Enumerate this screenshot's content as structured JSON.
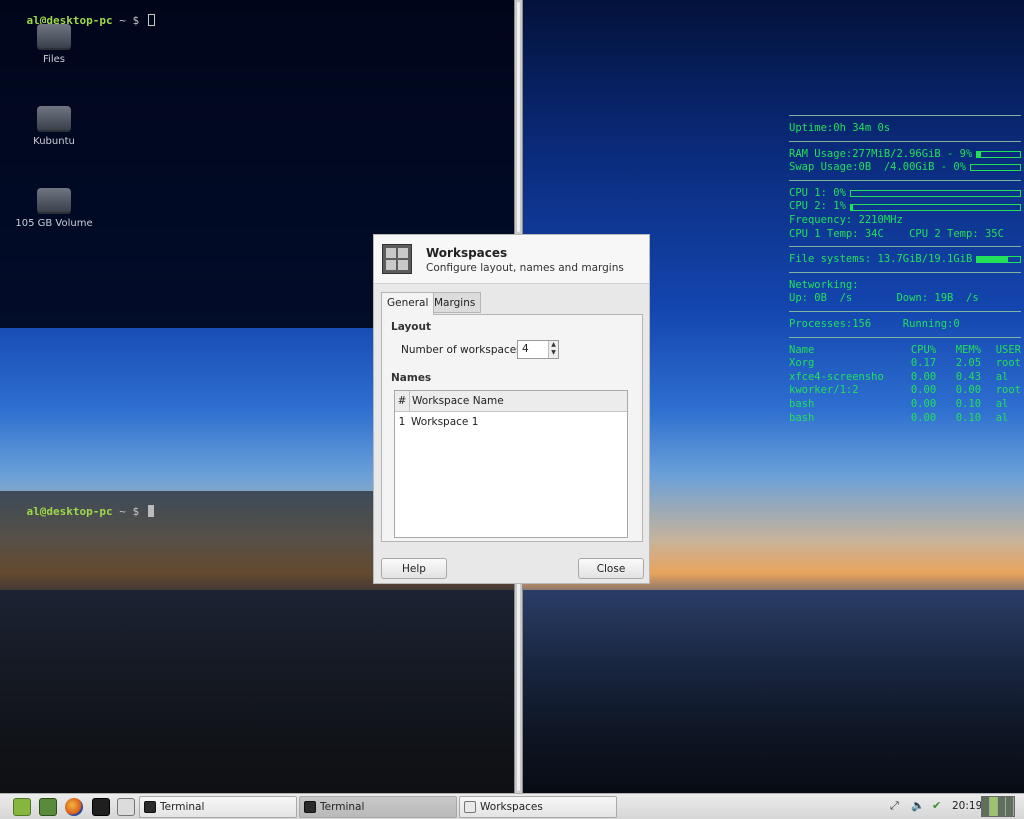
{
  "terminals": {
    "top": {
      "prompt_user": "al@desktop-pc",
      "prompt_rest": " ~ $ "
    },
    "bottom": {
      "prompt_user": "al@desktop-pc",
      "prompt_rest": " ~ $ "
    }
  },
  "desktop_icons": [
    {
      "label": "Files",
      "icon": "drive-icon"
    },
    {
      "label": "Kubuntu",
      "icon": "drive-icon"
    },
    {
      "label": "105 GB Volume",
      "icon": "drive-icon"
    }
  ],
  "conky": {
    "uptime": "Uptime:0h 34m 0s",
    "ram": "RAM Usage:277MiB/2.96GiB - 9%",
    "ram_percent": 9,
    "swap": "Swap Usage:0B  /4.00GiB - 0%",
    "swap_percent": 0,
    "cpu1": "CPU 1: 0%",
    "cpu1_percent": 0,
    "cpu2": "CPU 2: 1%",
    "cpu2_percent": 1,
    "frequency": "Frequency: 2210MHz",
    "temps": "CPU 1 Temp: 34C    CPU 2 Temp: 35C",
    "filesystems": "File systems: 13.7GiB/19.1GiB",
    "fs_percent": 72,
    "networking": "Networking:",
    "net": "Up: 0B  /s       Down: 19B  /s",
    "processes": "Processes:156     Running:0",
    "proc_headers": [
      "Name",
      "CPU%",
      "MEM%",
      "USER"
    ],
    "procs": [
      [
        "Xorg",
        "0.17",
        "2.05",
        "root"
      ],
      [
        "xfce4-screensho",
        "0.00",
        "0.43",
        "al"
      ],
      [
        "kworker/1:2",
        "0.00",
        "0.00",
        "root"
      ],
      [
        "bash",
        "0.00",
        "0.10",
        "al"
      ],
      [
        "bash",
        "0.00",
        "0.10",
        "al"
      ]
    ]
  },
  "dialog": {
    "title": "Workspaces",
    "subtitle": "Configure layout, names and margins",
    "tabs": [
      "General",
      "Margins"
    ],
    "layout_heading": "Layout",
    "num_label": "Number of workspaces:",
    "num_value": "4",
    "names_heading": "Names",
    "col_num": "#",
    "col_name": "Workspace Name",
    "rows": [
      {
        "num": "1",
        "name": "Workspace 1"
      }
    ],
    "help_button": "Help",
    "close_button": "Close"
  },
  "taskbar": {
    "tasks": [
      {
        "label": "Terminal",
        "icon": "terminal-icon",
        "active": false
      },
      {
        "label": "Terminal",
        "icon": "terminal-icon",
        "active": true
      },
      {
        "label": "Workspaces",
        "icon": "workspaces-icon",
        "active": false
      }
    ],
    "clock": "20:19",
    "tray_icons": [
      "network-icon",
      "volume-icon",
      "shield-icon"
    ]
  }
}
